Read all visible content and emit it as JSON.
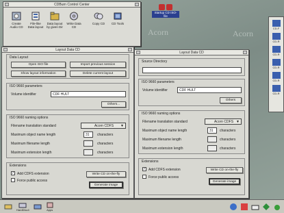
{
  "desktop": {
    "right_icons": [
      {
        "label": "CD-F",
        "color": "#3a5fae"
      },
      {
        "label": "CD-R",
        "color": "#3a5fae"
      },
      {
        "label": "CD-R",
        "color": "#3a5fae"
      },
      {
        "label": "CD-R",
        "color": "#3a5fae"
      },
      {
        "label": "CD-R",
        "color": "#3a5fae"
      },
      {
        "label": "CD-R",
        "color": "#3a5fae"
      }
    ],
    "backdrop_text": "Acorn"
  },
  "toolbar_window": {
    "title": "CDBurn Control Center",
    "tools": [
      {
        "label": "Create Audio CD",
        "icon": "audio-cd-icon"
      },
      {
        "label": "File-like Data layout",
        "icon": "data-layout-icon"
      },
      {
        "label": "Data layout by given Dir",
        "icon": "dir-layout-icon"
      },
      {
        "label": "Write Data CD",
        "icon": "write-cd-icon"
      },
      {
        "label": "Copy CD",
        "icon": "copy-cd-icon"
      },
      {
        "label": "CD Tools",
        "icon": "cd-tools-icon"
      }
    ]
  },
  "iso_icon": {
    "label": "Startup CD ISO-file"
  },
  "left_window": {
    "title": "Layout Data CD",
    "data_layout": {
      "heading": "Data Layout",
      "open_iso": "Open ISO file",
      "import_session": "Import previous session",
      "show_info": "Show layout information",
      "delete_layout": "Delete current layout"
    },
    "iso_params": {
      "heading": "ISO 9660 parameters",
      "volume_label": "Volume identifier",
      "volume_value": "CDF HULT",
      "others": "Others..."
    },
    "naming": {
      "heading": "ISO 9660 naming options",
      "translation_label": "Filename translation standard",
      "translation_value": "Acorn CDFS",
      "depth_label": "Maximum object name length",
      "depth_value": "31",
      "filename_label": "Maximum filename length",
      "extension_label": "Maximum extension length",
      "unit": "characters"
    },
    "extensions": {
      "heading": "Extensions",
      "cdfs_ext": "Add CDFS extension",
      "force_public": "Force public access",
      "write_fly": "Write CD on-the-fly",
      "generate": "Generate image"
    }
  },
  "right_window": {
    "title": "Layout Data CD",
    "source": {
      "heading": "Source Directory"
    },
    "iso_params": {
      "heading": "ISO 9660 parameters",
      "volume_label": "Volume identifier",
      "volume_value": "CDF HULT",
      "others": "Others"
    },
    "naming": {
      "heading": "ISO 9660 naming options",
      "translation_label": "Filename translation standard",
      "translation_value": "Acorn CDFS",
      "depth_label": "Maximum object name length",
      "depth_value": "31",
      "filename_label": "Maximum filename length",
      "extension_label": "Maximum extension length",
      "unit": "characters"
    },
    "extensions": {
      "heading": "Extensions",
      "cdfs_ext": "Add CDFS extension",
      "force_public": "Force public access",
      "write_fly": "Write CD on-the-fly",
      "generate": "Generate image"
    }
  },
  "iconbar": {
    "items": [
      {
        "label": "",
        "icon": "drive-icon"
      },
      {
        "label": "HardDisc4",
        "icon": "harddisc-icon"
      },
      {
        "label": "",
        "icon": "drive-icon"
      },
      {
        "label": "Apps",
        "icon": "apps-icon"
      }
    ]
  }
}
